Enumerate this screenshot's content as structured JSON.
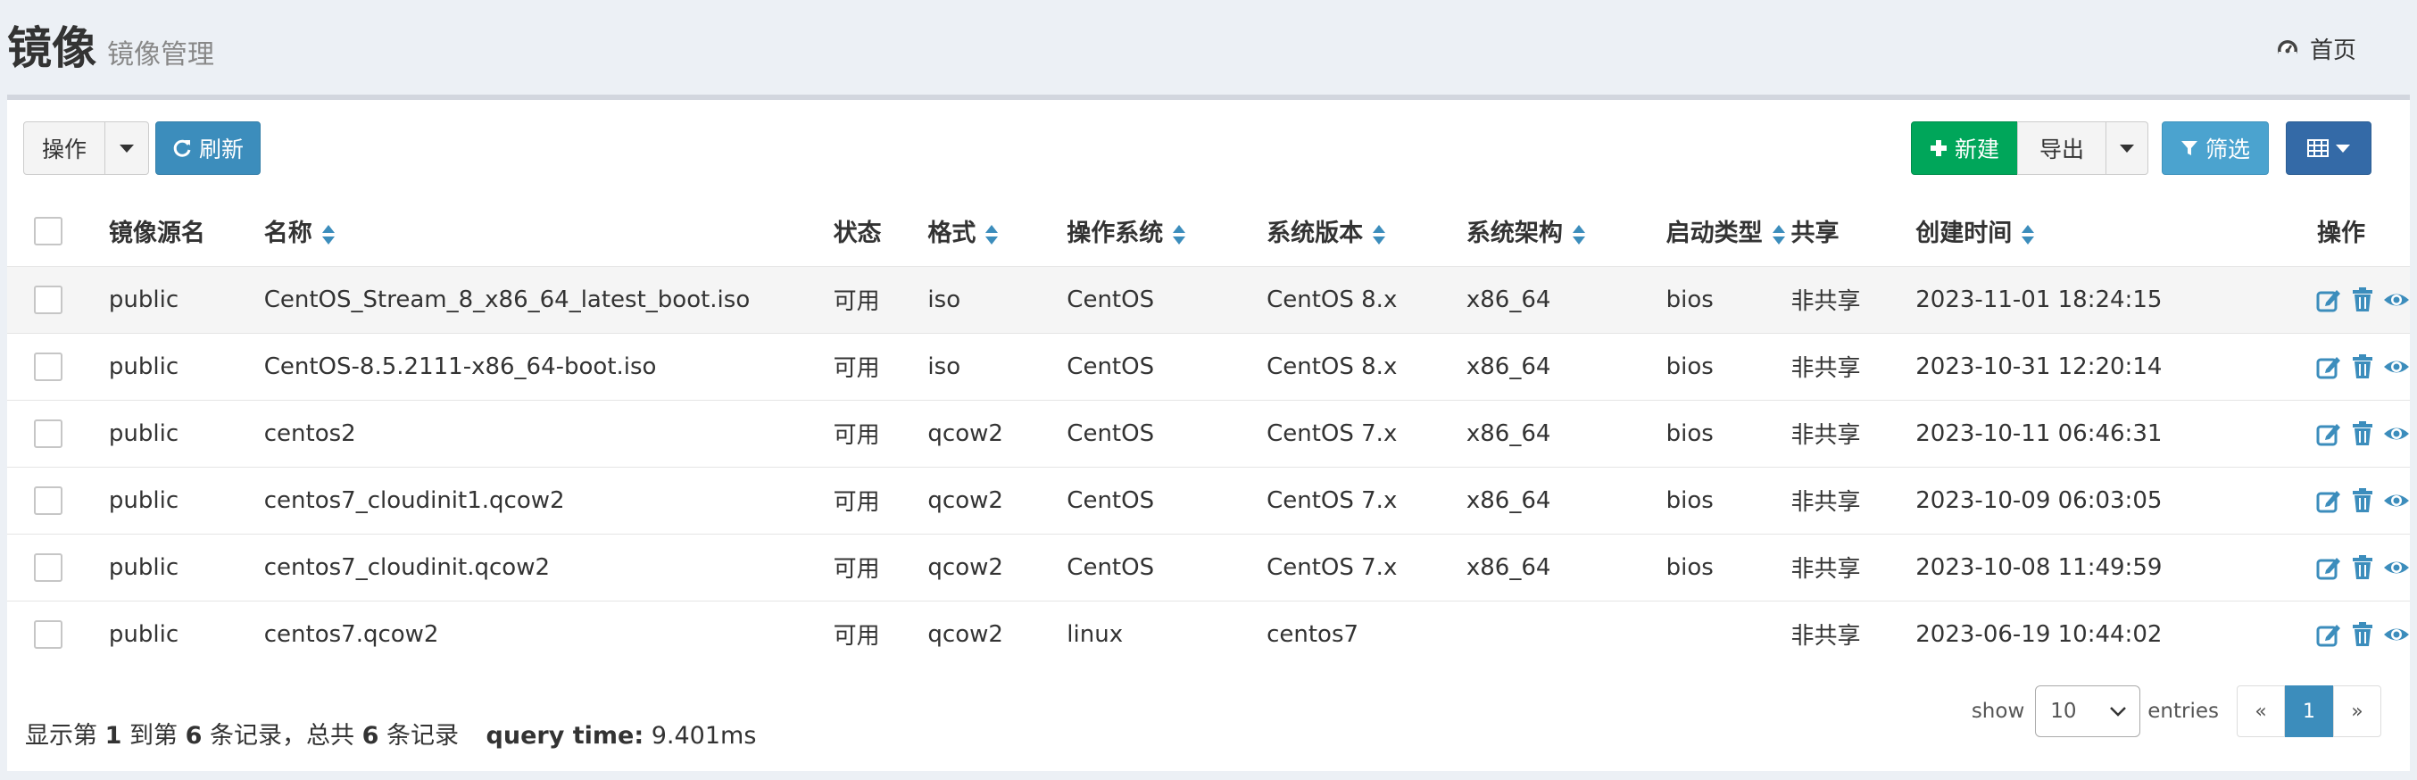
{
  "header": {
    "title": "镜像",
    "subtitle": "镜像管理",
    "home_label": "首页"
  },
  "toolbar": {
    "action_label": "操作",
    "refresh_label": "刷新",
    "new_label": "新建",
    "export_label": "导出",
    "filter_label": "筛选"
  },
  "table": {
    "columns": [
      "镜像源名",
      "名称",
      "状态",
      "格式",
      "操作系统",
      "系统版本",
      "系统架构",
      "启动类型",
      "共享",
      "创建时间",
      "操作"
    ],
    "rows": [
      {
        "source": "public",
        "name": "CentOS_Stream_8_x86_64_latest_boot.iso",
        "status": "可用",
        "format": "iso",
        "os": "CentOS",
        "version": "CentOS 8.x",
        "arch": "x86_64",
        "boot": "bios",
        "share": "非共享",
        "created": "2023-11-01 18:24:15"
      },
      {
        "source": "public",
        "name": "CentOS-8.5.2111-x86_64-boot.iso",
        "status": "可用",
        "format": "iso",
        "os": "CentOS",
        "version": "CentOS 8.x",
        "arch": "x86_64",
        "boot": "bios",
        "share": "非共享",
        "created": "2023-10-31 12:20:14"
      },
      {
        "source": "public",
        "name": "centos2",
        "status": "可用",
        "format": "qcow2",
        "os": "CentOS",
        "version": "CentOS 7.x",
        "arch": "x86_64",
        "boot": "bios",
        "share": "非共享",
        "created": "2023-10-11 06:46:31"
      },
      {
        "source": "public",
        "name": "centos7_cloudinit1.qcow2",
        "status": "可用",
        "format": "qcow2",
        "os": "CentOS",
        "version": "CentOS 7.x",
        "arch": "x86_64",
        "boot": "bios",
        "share": "非共享",
        "created": "2023-10-09 06:03:05"
      },
      {
        "source": "public",
        "name": "centos7_cloudinit.qcow2",
        "status": "可用",
        "format": "qcow2",
        "os": "CentOS",
        "version": "CentOS 7.x",
        "arch": "x86_64",
        "boot": "bios",
        "share": "非共享",
        "created": "2023-10-08 11:49:59"
      },
      {
        "source": "public",
        "name": "centos7.qcow2",
        "status": "可用",
        "format": "qcow2",
        "os": "linux",
        "version": "centos7",
        "arch": "",
        "boot": "",
        "share": "非共享",
        "created": "2023-06-19 10:44:02"
      }
    ]
  },
  "footer": {
    "info_prefix": "显示第",
    "from": "1",
    "to_word": "到第",
    "to": "6",
    "total_word": "条记录，总共",
    "total": "6",
    "records_word": "条记录",
    "query_time_label": "query time:",
    "query_time_value": "9.401ms"
  },
  "pager": {
    "show_label": "show",
    "page_size": "10",
    "entries_label": "entries",
    "prev": "«",
    "current_page": "1",
    "next": "»"
  },
  "colors": {
    "primary": "#3c8dbc",
    "success": "#00a65a",
    "info": "#4ba3cf",
    "dark_primary": "#346aa7"
  }
}
